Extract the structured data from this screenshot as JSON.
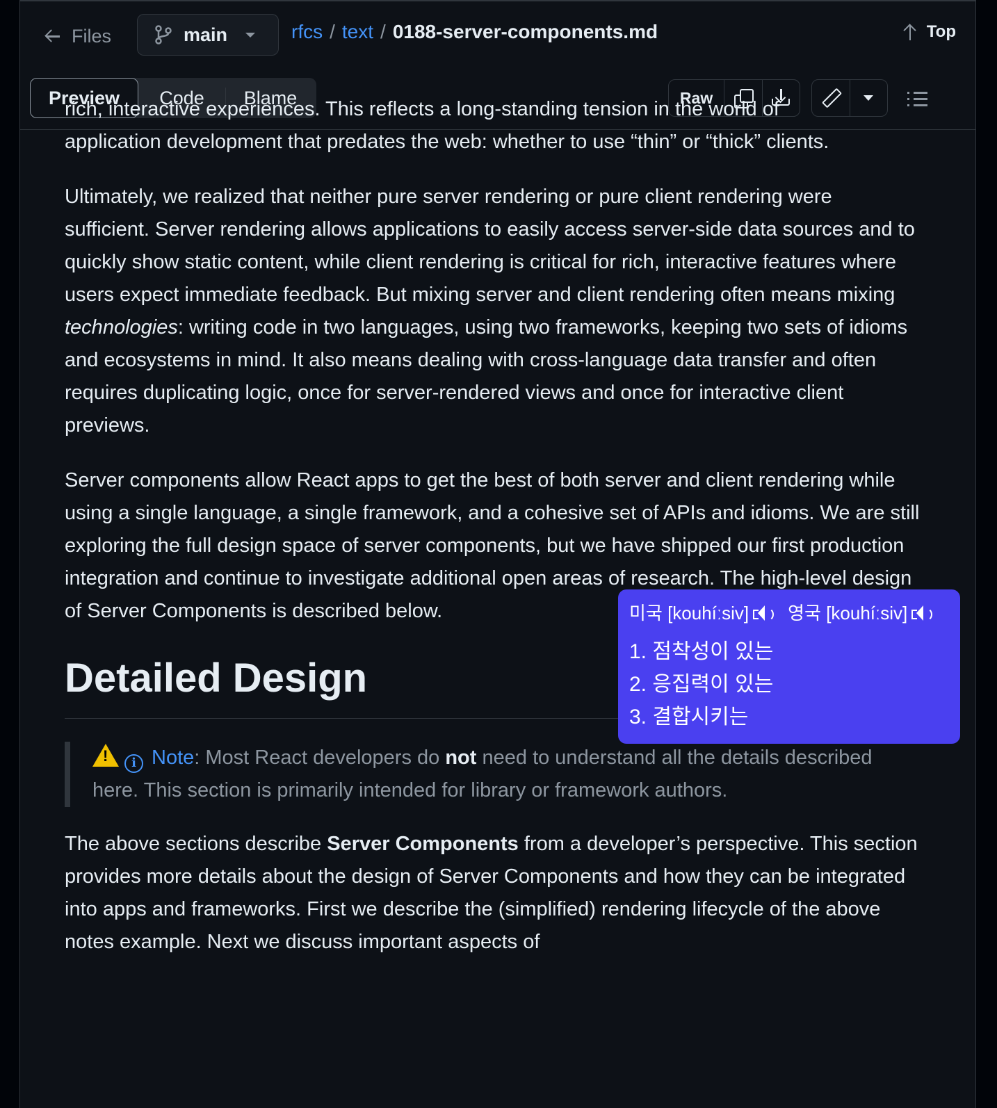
{
  "header": {
    "files_label": "Files",
    "branch": "main",
    "breadcrumb": [
      "rfcs",
      "text"
    ],
    "separator": "/",
    "file_name": "0188-server-components.md",
    "top_label": "Top"
  },
  "toolbar": {
    "tabs": [
      "Preview",
      "Code",
      "Blame"
    ],
    "raw_label": "Raw"
  },
  "content": {
    "clipped_line": "rich, interactive experiences. This reflects a long-standing tension in the world of",
    "p1_rest": "application development that predates the web: whether to use “thin” or “thick” clients.",
    "p2_a": "Ultimately, we realized that neither pure server rendering or pure client rendering were sufficient. Server rendering allows applications to easily access server-side data sources and to quickly show static content, while client rendering is critical for rich, interactive features where users expect immediate feedback. But mixing server and client rendering often means mixing ",
    "p2_em": "technologies",
    "p2_b": ": writing code in two languages, using two frameworks, keeping two sets of idioms and ecosystems in mind. It also means dealing with cross-language data transfer and often requires duplicating logic, once for server-rendered views and once for interactive client previews.",
    "p3": "Server components allow React apps to get the best of both server and client rendering while using a single language, a single framework, and a cohesive set of APIs and idioms. We are still exploring the full design space of server components, but we have shipped our first production integration and continue to investigate additional open areas of research. The high-level design of Server Components is described below.",
    "h2": "Detailed Design",
    "note_label": "Note",
    "note_a": ": Most React developers do ",
    "note_strong": "not",
    "note_b": " need to understand all the details described here. This section is primarily intended for library or framework authors.",
    "p4_a": "The above sections describe ",
    "p4_strong": "Server Components",
    "p4_b": " from a developer’s perspective. This section provides more details about the design of Server Components and how they can be integrated into apps and frameworks. First we describe the (simplified) rendering lifecycle of the above notes example. Next we discuss important aspects of"
  },
  "popup": {
    "us_label": "미국 [kouhíːsiv]",
    "uk_label": "영국 [kouhíːsiv]",
    "meanings": [
      "1. 점착성이 있는",
      "2. 응집력이 있는",
      "3. 결합시키는"
    ],
    "bg_color": "#4a40f0"
  },
  "colors": {
    "background": "#0d1117",
    "link": "#4493f8",
    "muted": "#8d96a0",
    "border": "#30363d"
  }
}
